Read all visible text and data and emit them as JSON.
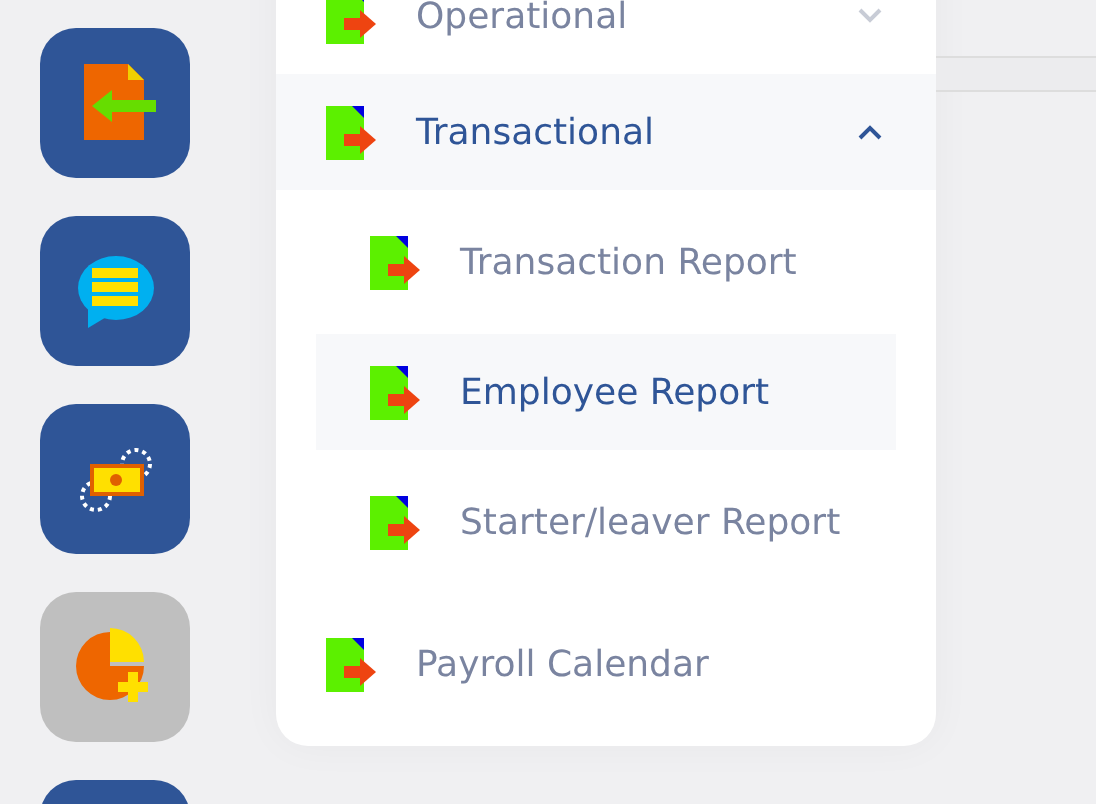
{
  "sidebar": {
    "tiles": [
      {
        "kind": "import",
        "disabled": false
      },
      {
        "kind": "chat",
        "disabled": false
      },
      {
        "kind": "money",
        "disabled": false
      },
      {
        "kind": "chart",
        "disabled": true
      },
      {
        "kind": "blank",
        "disabled": false
      }
    ]
  },
  "menu": {
    "items": [
      {
        "label": "Operational",
        "kind": "group",
        "expanded": false
      },
      {
        "label": "Transactional",
        "kind": "group",
        "expanded": true,
        "children": [
          {
            "label": "Transaction Report",
            "selected": false
          },
          {
            "label": "Employee Report",
            "selected": true
          },
          {
            "label": "Starter/leaver Report",
            "selected": false
          }
        ]
      },
      {
        "label": "Payroll Calendar",
        "kind": "link",
        "expanded": false
      }
    ]
  }
}
